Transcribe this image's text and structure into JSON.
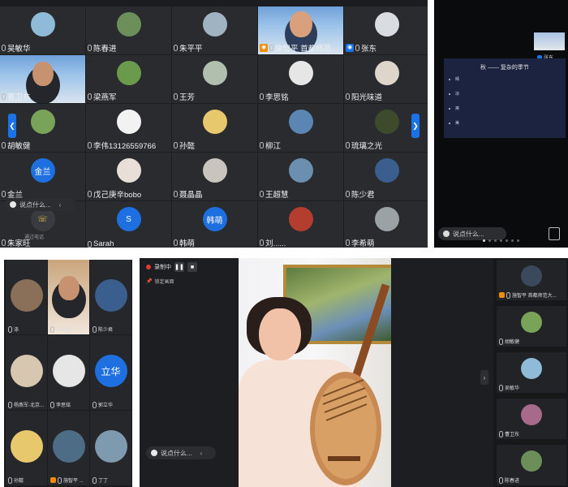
{
  "panel1": {
    "participants": [
      {
        "name": "吴敏华",
        "bg": "#8fbbd8"
      },
      {
        "name": "陈春进",
        "bg": "#6c8f5a"
      },
      {
        "name": "朱平平",
        "bg": "#9fb3c2"
      },
      {
        "name": "施智平 首都师范...",
        "bg": "video",
        "host": true
      },
      {
        "name": "张东",
        "bg": "#d9dde2",
        "cohost": true
      },
      {
        "name": "曹卫东",
        "bg": "video2"
      },
      {
        "name": "梁燕军",
        "bg": "#6a9b4c"
      },
      {
        "name": "王芳",
        "bg": "#b0bfae"
      },
      {
        "name": "李思铭",
        "bg": "#e6e6e6"
      },
      {
        "name": "阳光味道",
        "bg": "#ded6cb"
      },
      {
        "name": "胡敏健",
        "bg": "#7aa35a"
      },
      {
        "name": "李伟13126559766",
        "bg": "#f2f2f2"
      },
      {
        "name": "孙懿",
        "bg": "#e7c86c"
      },
      {
        "name": "柳江",
        "bg": "#5b86b3"
      },
      {
        "name": "琉璃之光",
        "bg": "#3d4a2c"
      },
      {
        "name": "金兰",
        "bg": "#1e6fe0",
        "initials": "金兰"
      },
      {
        "name": "戊己庚辛bobo",
        "bg": "#e8dfd8"
      },
      {
        "name": "聂晶晶",
        "bg": "#c9c4be"
      },
      {
        "name": "王超慧",
        "bg": "#6b8fae"
      },
      {
        "name": "陈少君",
        "bg": "#3a5e8e"
      },
      {
        "name": "朱家旺",
        "bg": "#2a2b2f",
        "phone": true
      },
      {
        "name": "Sarah",
        "bg": "#1e6fe0",
        "initials": "S"
      },
      {
        "name": "韩萌",
        "bg": "#1e6fe0",
        "initials": "韩萌"
      },
      {
        "name": "刘......",
        "bg": "#b33d2e"
      },
      {
        "name": "李希萌",
        "bg": "#9aa2a6"
      }
    ],
    "say_placeholder": "说点什么...",
    "phone_note": "通过电话"
  },
  "panel2": {
    "slide_title": "秋 —— 复杂的季节",
    "items": [
      "晴",
      "凉",
      "爽",
      "美"
    ],
    "self_name": "张东",
    "say_placeholder": "说点什么..."
  },
  "panel3": {
    "participants": [
      {
        "name": "涤",
        "bg": "#8a7058"
      },
      {
        "name": "王昭旭",
        "bg": "video3"
      },
      {
        "name": "陈少君",
        "bg": "#3a5e8e"
      },
      {
        "name": "杨燕军-北京...",
        "bg": "#d8c7b0"
      },
      {
        "name": "李思铭",
        "bg": "#e6e6e6"
      },
      {
        "name": "郭立华",
        "bg": "#1e6fe0",
        "initials": "立华"
      },
      {
        "name": "孙懿",
        "bg": "#e7c86c"
      },
      {
        "name": "施智平 ...",
        "bg": "#4d6c86",
        "host": true
      },
      {
        "name": "丁丁",
        "bg": "#7d9aae"
      }
    ]
  },
  "panel4": {
    "record_label": "录制中",
    "lock_label": "锁定画面",
    "say_placeholder": "说点什么...",
    "side": [
      {
        "name": "施智平 首都师范大...",
        "bg": "#3a4a5c",
        "host": true
      },
      {
        "name": "胡敏健",
        "bg": "#7aa35a"
      },
      {
        "name": "吴敏华",
        "bg": "#8fbbd8"
      },
      {
        "name": "曹卫东",
        "bg": "#a86a8a"
      },
      {
        "name": "陈春进",
        "bg": "#6c8f5a"
      }
    ]
  }
}
